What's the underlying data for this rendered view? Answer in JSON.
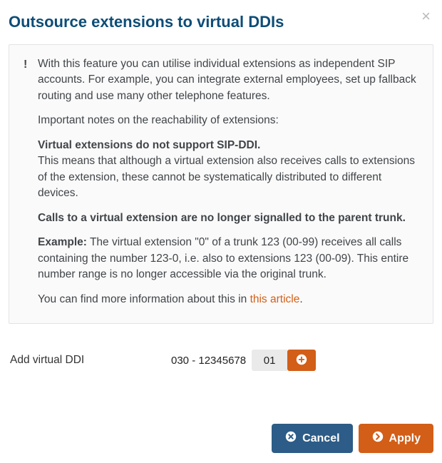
{
  "modal": {
    "title": "Outsource extensions to virtual DDIs",
    "close_icon": "×"
  },
  "info": {
    "intro": "With this feature you can utilise individual extensions as independent SIP accounts. For example, you can integrate external employees, set up fallback routing and use many other telephone features.",
    "notes_heading": "Important notes on the reachability of extensions:",
    "no_sip_ddi_bold": "Virtual extensions do not support SIP-DDI.",
    "no_sip_ddi_detail": "This means that although a virtual extension also receives calls to extensions of the extension, these cannot be systematically distributed to different devices.",
    "no_parent_signal_bold": "Calls to a virtual extension are no longer signalled to the parent trunk.",
    "example_label": "Example:",
    "example_text": " The virtual extension \"0\" of a trunk 123 (00-99) receives all calls containing the number 123-0, i.e. also to extensions 123 (00-09). This entire number range is no longer accessible via the original trunk.",
    "more_info_prefix": "You can find more information about this in ",
    "more_info_link": "this article",
    "more_info_suffix": "."
  },
  "add": {
    "label": "Add virtual DDI",
    "prefix": "030 - 12345678",
    "ext_value": "01"
  },
  "buttons": {
    "cancel": "Cancel",
    "apply": "Apply"
  }
}
